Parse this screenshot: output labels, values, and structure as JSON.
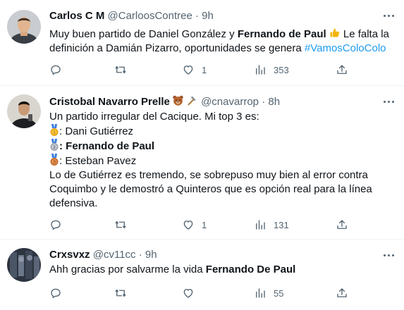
{
  "tweets": [
    {
      "name": "Carlos C M",
      "handle": "@CarloosContree",
      "separator": "·",
      "time": "9h",
      "text_parts": {
        "p1": "Muy buen partido de Daniel González y ",
        "p2": "Fernando de Paul",
        "p3": " Le falta la definición a Damián Pizarro, oportunidades se genera ",
        "hashtag": "#VamosColoColo"
      },
      "replies": "",
      "retweets": "",
      "likes": "1",
      "views": "353"
    },
    {
      "name": "Cristobal Navarro Prelle",
      "handle": "@cnavarrop",
      "separator": "·",
      "time": "8h",
      "lines": {
        "l1": "Un partido irregular del Cacique. Mi top 3 es:",
        "l2": ": Dani Gutiérrez",
        "l3": ": Fernando de Paul",
        "l4": ": Esteban Pavez",
        "l5": "Lo de Gutiérrez es tremendo, se sobrepuso muy bien al error contra Coquimbo y le demostró a Quinteros que es opción real para la línea defensiva."
      },
      "replies": "",
      "retweets": "",
      "likes": "1",
      "views": "131"
    },
    {
      "name": "Crxsvxz",
      "handle": "@cv11cc",
      "separator": "·",
      "time": "9h",
      "text_parts": {
        "p1": "Ahh gracias por salvarme la vida ",
        "p2": "Fernando De Paul"
      },
      "replies": "",
      "retweets": "",
      "likes": "",
      "views": "55"
    }
  ],
  "icons": [
    "more-icon",
    "reply-icon",
    "retweet-icon",
    "like-icon",
    "views-icon",
    "share-icon",
    "thumbs-up-emoji",
    "bear-emoji",
    "hammer-emoji",
    "gold-medal-emoji",
    "silver-medal-emoji",
    "bronze-medal-emoji"
  ],
  "colors": {
    "text": "#0f1419",
    "secondary": "#536471",
    "link": "#1d9bf0",
    "divider": "#eff3f4",
    "thumb": "#f4b400"
  }
}
